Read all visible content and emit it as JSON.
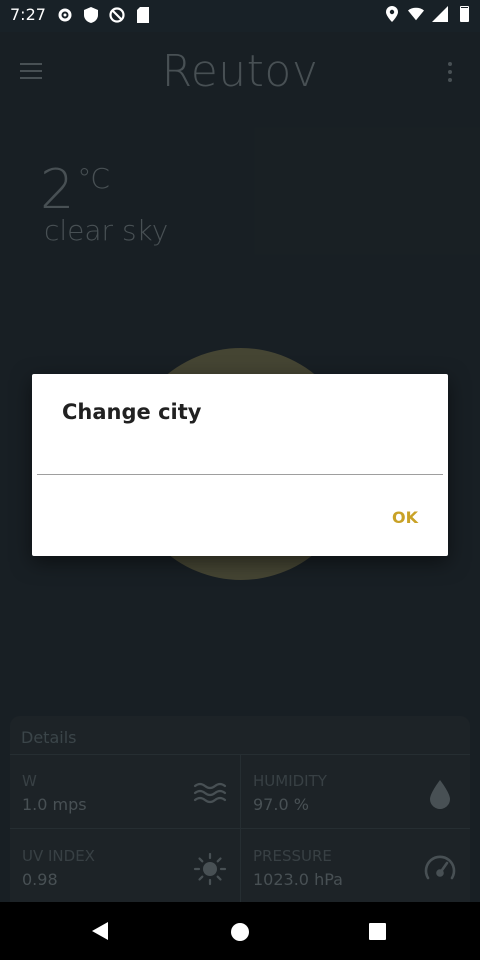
{
  "status_bar": {
    "time": "7:27",
    "battery_fraction": 0.9,
    "icons_left": [
      "gear-icon",
      "shield-icon",
      "no-disturb-icon",
      "sd-card-icon"
    ],
    "icons_right": [
      "location-icon",
      "wifi-icon",
      "signal-icon",
      "battery-icon"
    ]
  },
  "app_bar": {
    "title": "Reutov"
  },
  "weather": {
    "temperature": "2",
    "unit": "°C",
    "condition": "clear sky"
  },
  "dialog": {
    "title": "Change city",
    "input_value": "",
    "input_placeholder": "",
    "ok_label": "OK",
    "accent_color": "#c9a227"
  },
  "details": {
    "header": "Details",
    "wind": {
      "label": "W",
      "value": "1.0 mps",
      "icon": "wind-icon"
    },
    "humidity": {
      "label": "HUMIDITY",
      "value": "97.0 %",
      "icon": "drop-icon"
    },
    "uv": {
      "label": "UV INDEX",
      "value": "0.98",
      "icon": "sun-icon"
    },
    "pressure": {
      "label": "PRESSURE",
      "value": "1023.0 hPa",
      "icon": "gauge-icon"
    }
  },
  "colors": {
    "background": "#263138",
    "card": "#2d373d",
    "muted_text": "#6f7b81",
    "sun_circle": "#6b6a4f"
  }
}
